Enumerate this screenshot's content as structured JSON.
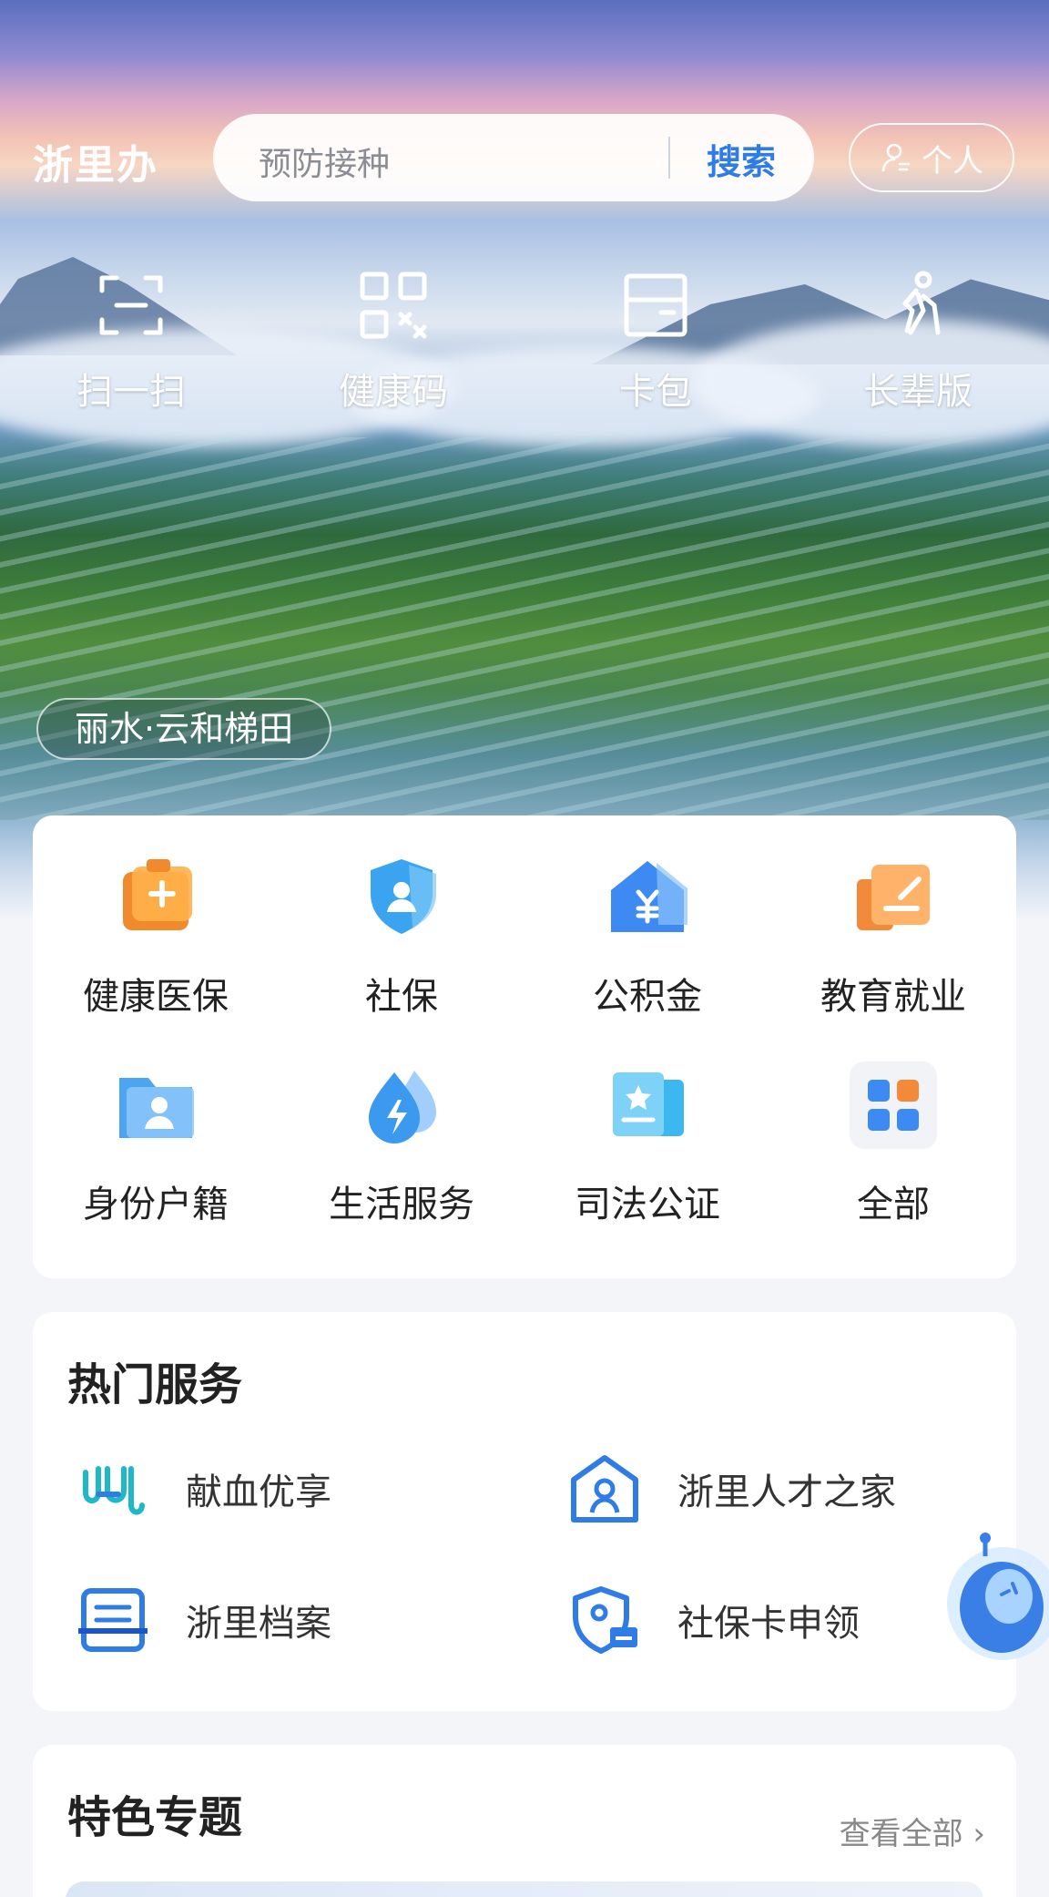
{
  "app": {
    "brand": "浙里办"
  },
  "search": {
    "placeholder": "预防接种",
    "button": "搜索"
  },
  "personal": {
    "label": "个人"
  },
  "quick_actions": [
    {
      "label": "扫一扫",
      "icon": "scan-icon"
    },
    {
      "label": "健康码",
      "icon": "qrcode-icon"
    },
    {
      "label": "卡包",
      "icon": "card-wallet-icon"
    },
    {
      "label": "长辈版",
      "icon": "elder-icon"
    }
  ],
  "location": "丽水·云和梯田",
  "categories": [
    {
      "label": "健康医保",
      "icon": "medical-kit-icon",
      "color": "#f08a2c"
    },
    {
      "label": "社保",
      "icon": "social-security-shield-icon",
      "color": "#3aa4f0"
    },
    {
      "label": "公积金",
      "icon": "housing-fund-icon",
      "color": "#3d8bf2"
    },
    {
      "label": "教育就业",
      "icon": "education-icon",
      "color": "#f28a3a"
    },
    {
      "label": "身份户籍",
      "icon": "id-folder-icon",
      "color": "#4da5f2"
    },
    {
      "label": "生活服务",
      "icon": "life-service-drop-icon",
      "color": "#3b9af0"
    },
    {
      "label": "司法公证",
      "icon": "notary-icon",
      "color": "#3cb7f0"
    },
    {
      "label": "全部",
      "icon": "all-grid-icon",
      "color": "#3d8bf2"
    }
  ],
  "hot_services": {
    "title": "热门服务",
    "items": [
      {
        "label": "献血优享",
        "icon": "blood-donation-icon"
      },
      {
        "label": "浙里人才之家",
        "icon": "talent-home-icon"
      },
      {
        "label": "浙里档案",
        "icon": "archive-icon"
      },
      {
        "label": "社保卡申领",
        "icon": "social-card-apply-icon"
      }
    ]
  },
  "featured": {
    "title": "特色专题",
    "view_all": "查看全部"
  },
  "colors": {
    "accent": "#2f7ce6",
    "text": "#222222",
    "bg": "#f3f5f9"
  }
}
